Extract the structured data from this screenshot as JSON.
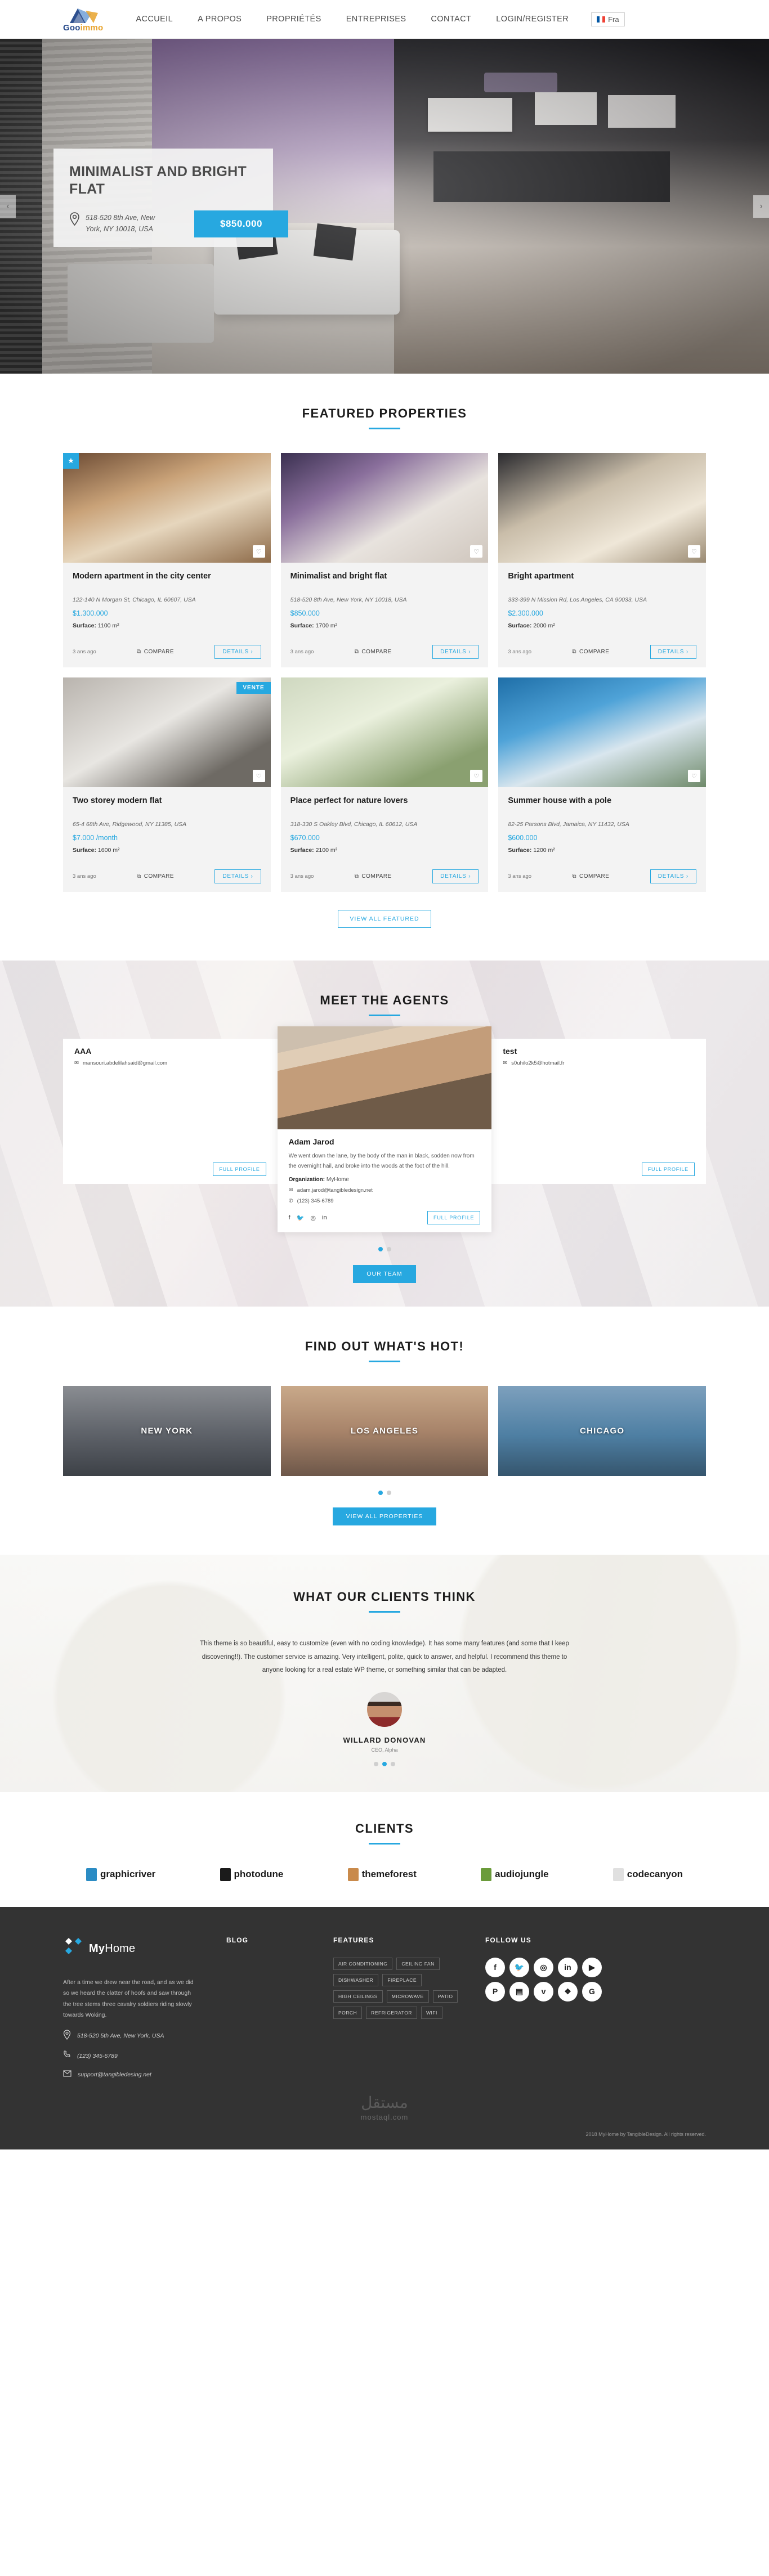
{
  "header": {
    "logo_brand": "Goo",
    "logo_brand2": "immo",
    "nav": [
      {
        "label": "ACCUEIL"
      },
      {
        "label": "A PROPOS"
      },
      {
        "label": "PROPRIÉTÉS"
      },
      {
        "label": "ENTREPRISES"
      },
      {
        "label": "CONTACT"
      },
      {
        "label": "LOGIN/REGISTER"
      }
    ],
    "language": "Fra"
  },
  "hero": {
    "title": "MINIMALIST AND BRIGHT FLAT",
    "address": "518-520 8th Ave, New York, NY 10018, USA",
    "price": "$850.000",
    "prev": "‹",
    "next": "›"
  },
  "featured": {
    "title": "FEATURED PROPERTIES",
    "view_all": "VIEW ALL FEATURED",
    "compare_label": "COMPARE",
    "details_label": "DETAILS ›",
    "surface_label": "Surface:",
    "properties": [
      {
        "title": "Modern apartment in the city center",
        "address": "122-140 N Morgan St, Chicago, IL 60607, USA",
        "price": "$1.300.000",
        "surface": "1100 m²",
        "ago": "3 ans ago",
        "badge": "featured",
        "badge_label": ""
      },
      {
        "title": "Minimalist and bright flat",
        "address": "518-520 8th Ave, New York, NY 10018, USA",
        "price": "$850.000",
        "surface": "1700 m²",
        "ago": "3 ans ago",
        "badge": "none",
        "badge_label": ""
      },
      {
        "title": "Bright apartment",
        "address": "333-399 N Mission Rd, Los Angeles, CA 90033, USA",
        "price": "$2.300.000",
        "surface": "2000 m²",
        "ago": "3 ans ago",
        "badge": "none",
        "badge_label": ""
      },
      {
        "title": "Two storey modern flat",
        "address": "65-4 68th Ave, Ridgewood, NY 11385, USA",
        "price": "$7.000 /month",
        "surface": "1600 m²",
        "ago": "3 ans ago",
        "badge": "sale",
        "badge_label": "VENTE"
      },
      {
        "title": "Place perfect for nature lovers",
        "address": "318-330 S Oakley Blvd, Chicago, IL 60612, USA",
        "price": "$670.000",
        "surface": "2100 m²",
        "ago": "3 ans ago",
        "badge": "none",
        "badge_label": ""
      },
      {
        "title": "Summer house with a pole",
        "address": "82-25 Parsons Blvd, Jamaica, NY 11432, USA",
        "price": "$600.000",
        "surface": "1200 m²",
        "ago": "3 ans ago",
        "badge": "none",
        "badge_label": ""
      }
    ]
  },
  "agents": {
    "title": "MEET THE AGENTS",
    "our_team": "OUR TEAM",
    "full_profile": "FULL PROFILE",
    "org_label": "Organization:",
    "list": [
      {
        "name": "AAA",
        "desc": "",
        "org": "",
        "email": "mansouri.abdelilahsaid@gmail.com",
        "phone": "",
        "has_socials": false
      },
      {
        "name": "Adam Jarod",
        "desc": "We went down the lane, by the body of the man in black, sodden now from the overnight hail, and broke into the woods at the foot of the hill.",
        "org": "MyHome",
        "email": "adam.jarod@tangibledesign.net",
        "phone": "(123) 345-6789",
        "has_socials": true
      },
      {
        "name": "test",
        "desc": "",
        "org": "",
        "email": "s0uhilo2k5@hotmail.fr",
        "phone": "",
        "has_socials": false
      }
    ]
  },
  "hot": {
    "title": "FIND OUT WHAT'S HOT!",
    "view_all": "VIEW ALL PROPERTIES",
    "cities": [
      {
        "name": "NEW YORK"
      },
      {
        "name": "LOS ANGELES"
      },
      {
        "name": "CHICAGO"
      }
    ]
  },
  "testimonial": {
    "title": "WHAT OUR CLIENTS THINK",
    "quote": "This theme is so beautiful, easy to customize (even with no coding knowledge). It has some many features (and some that I keep discovering!!). The customer service is amazing. Very intelligent, polite, quick to answer, and helpful. I recommend this theme to anyone looking for a real estate WP theme, or something similar that can be adapted.",
    "name": "WILLARD DONOVAN",
    "role": "CEO, Alpha"
  },
  "clients": {
    "title": "CLIENTS",
    "logos": [
      {
        "name": "graphicriver",
        "color": "#2b8cc4"
      },
      {
        "name": "photodune",
        "color": "#1b1b1b"
      },
      {
        "name": "themeforest",
        "color": "#c98a4b"
      },
      {
        "name": "audiojungle",
        "color": "#6a9b3a"
      },
      {
        "name": "codecanyon",
        "color": "#e0e0e0"
      }
    ]
  },
  "footer": {
    "brand_my": "My",
    "brand_home": "Home",
    "description": "After a time we drew near the road, and as we did so we heard the clatter of hoofs and saw through the tree stems three cavalry soldiers riding slowly towards Woking.",
    "address": "518-520 5th Ave, New York, USA",
    "phone": "(123) 345-6789",
    "email": "support@tangibledesing.net",
    "blog_heading": "BLOG",
    "features_heading": "FEATURES",
    "follow_heading": "FOLLOW US",
    "features": [
      {
        "label": "AIR CONDITIONING"
      },
      {
        "label": "CEILING FAN"
      },
      {
        "label": "DISHWASHER"
      },
      {
        "label": "FIREPLACE"
      },
      {
        "label": "HIGH CEILINGS"
      },
      {
        "label": "MICROWAVE"
      },
      {
        "label": "PATIO"
      },
      {
        "label": "PORCH"
      },
      {
        "label": "REFRIGERATOR"
      },
      {
        "label": "WIFI"
      }
    ],
    "socials": [
      {
        "name": "facebook-icon",
        "glyph": "f"
      },
      {
        "name": "twitter-icon",
        "glyph": "🐦"
      },
      {
        "name": "instagram-icon",
        "glyph": "◎"
      },
      {
        "name": "linkedin-icon",
        "glyph": "in"
      },
      {
        "name": "youtube-icon",
        "glyph": "▶"
      },
      {
        "name": "pinterest-icon",
        "glyph": "P"
      },
      {
        "name": "slideshare-icon",
        "glyph": "▤"
      },
      {
        "name": "vimeo-icon",
        "glyph": "v"
      },
      {
        "name": "dropbox-icon",
        "glyph": "❖"
      },
      {
        "name": "google-icon",
        "glyph": "G"
      }
    ],
    "watermark_ar": "مستقل",
    "watermark_lat": "mostaql.com",
    "copyright": "2018 MyHome by TangibleDesign. All rights reserved."
  },
  "colors": {
    "accent": "#27a8e0",
    "footer_bg": "#333333",
    "card_bg": "#f3f3f3"
  }
}
